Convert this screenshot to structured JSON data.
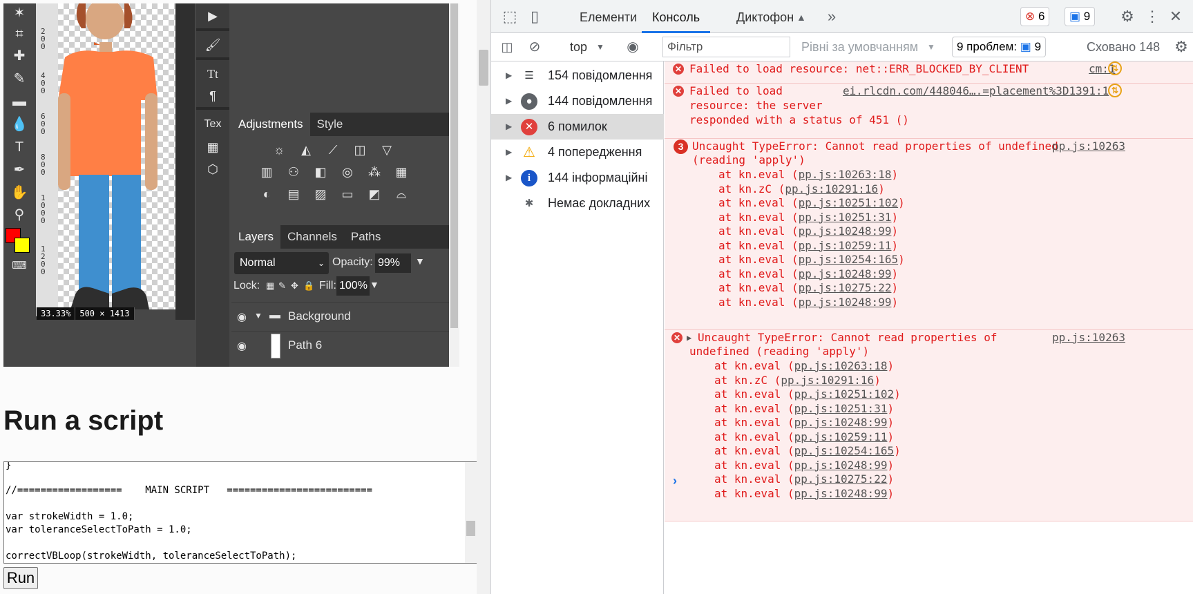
{
  "editor": {
    "zoom": "33.33%",
    "dimensions": "500 × 1413",
    "ruler_labels": [
      "200",
      "400",
      "600",
      "800",
      "1000",
      "1200"
    ],
    "mini_tex_label": "Tex",
    "adjust_tabs": [
      "Adjustments",
      "Style"
    ],
    "layer_tabs": [
      "Layers",
      "Channels",
      "Paths"
    ],
    "blend_mode": "Normal",
    "opacity_label": "Opacity:",
    "opacity_value": "99%",
    "lock_label": "Lock:",
    "fill_label": "Fill:",
    "fill_value": "100%",
    "layers": [
      {
        "name": "Background",
        "type": "group"
      },
      {
        "name": "Path 6",
        "type": "path"
      }
    ],
    "foreground_color": "#ff0000",
    "background_color": "#ffff00",
    "shirt_color": "#ff7f45",
    "pants_color": "#3f8fcf"
  },
  "script": {
    "title": "Run a script",
    "lines": [
      "}",
      "",
      "//==================    MAIN SCRIPT   =========================",
      "",
      "var strokeWidth = 1.0;",
      "var toleranceSelectToPath = 1.0;",
      "",
      "correctVBLoop(strokeWidth, toleranceSelectToPath);"
    ],
    "run_label": "Run"
  },
  "devtools": {
    "tabs": [
      "Елементи",
      "Консоль",
      "Диктофон"
    ],
    "active_tab": "Консоль",
    "error_count": "6",
    "message_count": "9",
    "context": "top",
    "filter_placeholder": "Фільтр",
    "levels": "Рівні за умовчанням",
    "issues_label": "9 проблем:",
    "issues_count": "9",
    "hidden_label": "Сховано 148",
    "sidebar": [
      {
        "label": "154 повідомлення",
        "icon": "list-icon"
      },
      {
        "label": "144 повідомлення",
        "icon": "user-icon"
      },
      {
        "label": "6 помилок",
        "icon": "error-icon"
      },
      {
        "label": "4 попередження",
        "icon": "warning-icon"
      },
      {
        "label": "144 інформаційні",
        "icon": "info-icon"
      },
      {
        "label": "Немає докладних",
        "icon": "bug-icon"
      }
    ],
    "messages": {
      "m1": {
        "text": "Failed to load resource: net::ERR_BLOCKED_BY_CLIENT",
        "source": "cm:1"
      },
      "m2": {
        "lines": [
          "Failed to load",
          "resource: the server",
          "responded with a status of 451 ()"
        ],
        "source": "ei.rlcdn.com/448046….=placement%3D1391:1"
      },
      "m3": {
        "count": "3",
        "lines": [
          "Uncaught TypeError: Cannot read properties of undefined",
          "(reading 'apply')"
        ],
        "source": "pp.js:10263"
      },
      "m4": {
        "lines": [
          "Uncaught TypeError: Cannot read properties of",
          "undefined (reading 'apply')"
        ],
        "source": "pp.js:10263"
      },
      "stack": [
        {
          "fn": "kn.eval",
          "loc": "pp.js:10263:18"
        },
        {
          "fn": "kn.zC",
          "loc": "pp.js:10291:16"
        },
        {
          "fn": "kn.eval",
          "loc": "pp.js:10251:102"
        },
        {
          "fn": "kn.eval",
          "loc": "pp.js:10251:31"
        },
        {
          "fn": "kn.eval",
          "loc": "pp.js:10248:99"
        },
        {
          "fn": "kn.eval",
          "loc": "pp.js:10259:11"
        },
        {
          "fn": "kn.eval",
          "loc": "pp.js:10254:165"
        },
        {
          "fn": "kn.eval",
          "loc": "pp.js:10248:99"
        },
        {
          "fn": "kn.eval",
          "loc": "pp.js:10275:22"
        },
        {
          "fn": "kn.eval",
          "loc": "pp.js:10248:99"
        }
      ]
    }
  }
}
